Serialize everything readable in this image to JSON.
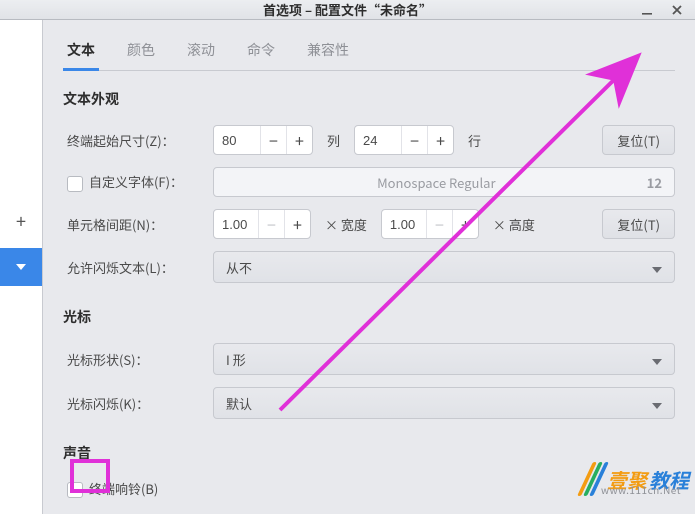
{
  "window": {
    "title": "首选项 – 配置文件“未命名”"
  },
  "tabs": [
    {
      "label": "文本",
      "active": true
    },
    {
      "label": "颜色"
    },
    {
      "label": "滚动"
    },
    {
      "label": "命令"
    },
    {
      "label": "兼容性"
    }
  ],
  "sections": {
    "appearance": {
      "title": "文本外观",
      "initial_size": {
        "label": "终端起始尺寸(Z)：",
        "cols": "80",
        "cols_unit": "列",
        "rows": "24",
        "rows_unit": "行",
        "reset": "复位(T)"
      },
      "custom_font": {
        "label": "自定义字体(F)：",
        "font_name": "Monospace Regular",
        "font_size": "12",
        "checked": false
      },
      "cell_spacing": {
        "label": "单元格间距(N)：",
        "width_val": "1.00",
        "width_unit": "× 宽度",
        "height_val": "1.00",
        "height_unit": "× 高度",
        "reset": "复位(T)"
      },
      "blink_text": {
        "label": "允许闪烁文本(L)：",
        "value": "从不"
      }
    },
    "cursor": {
      "title": "光标",
      "shape": {
        "label": "光标形状(S)：",
        "value": "I 形"
      },
      "blink": {
        "label": "光标闪烁(K)：",
        "value": "默认"
      }
    },
    "sound": {
      "title": "声音",
      "bell": {
        "label": "终端响铃(B)",
        "checked": false
      }
    }
  },
  "watermark": {
    "text1": "壹聚",
    "text2": "教程",
    "url": "www.111cn.Net"
  }
}
